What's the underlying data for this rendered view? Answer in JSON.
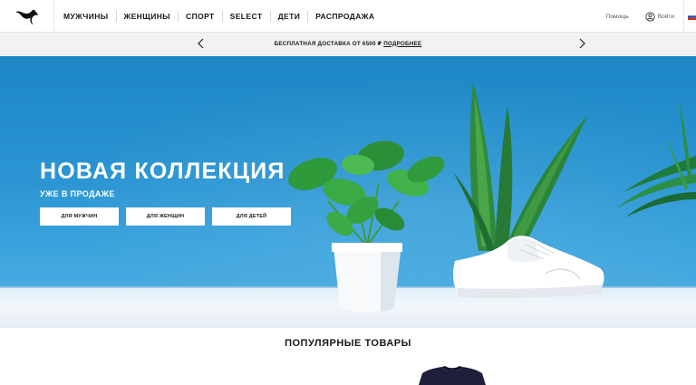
{
  "header": {
    "logo": "puma-cat-icon",
    "nav": [
      "МУЖЧИНЫ",
      "ЖЕНЩИНЫ",
      "СПОРТ",
      "SELECT",
      "ДЕТИ",
      "РАСПРОДАЖА"
    ],
    "help": "Помощь",
    "login": "Войти",
    "login_icon": "user-circle-icon",
    "flag_icon": "russia-flag-icon"
  },
  "promo": {
    "text": "БЕСПЛАТНАЯ ДОСТАВКА ОТ 6500 ₽",
    "link": "ПОДРОБНЕЕ",
    "prev_icon": "chevron-left-icon",
    "next_icon": "chevron-right-icon"
  },
  "hero": {
    "title": "НОВАЯ КОЛЛЕКЦИЯ",
    "subtitle": "УЖЕ В ПРОДАЖЕ",
    "buttons": [
      "ДЛЯ МУЖЧИН",
      "ДЛЯ ЖЕНЩИН",
      "ДЛЯ ДЕТЕЙ"
    ],
    "colors": {
      "sky": "#2a95d2",
      "table": "#f2f7fb"
    }
  },
  "popular": {
    "title": "ПОПУЛЯРНЫЕ ТОВАРЫ"
  }
}
